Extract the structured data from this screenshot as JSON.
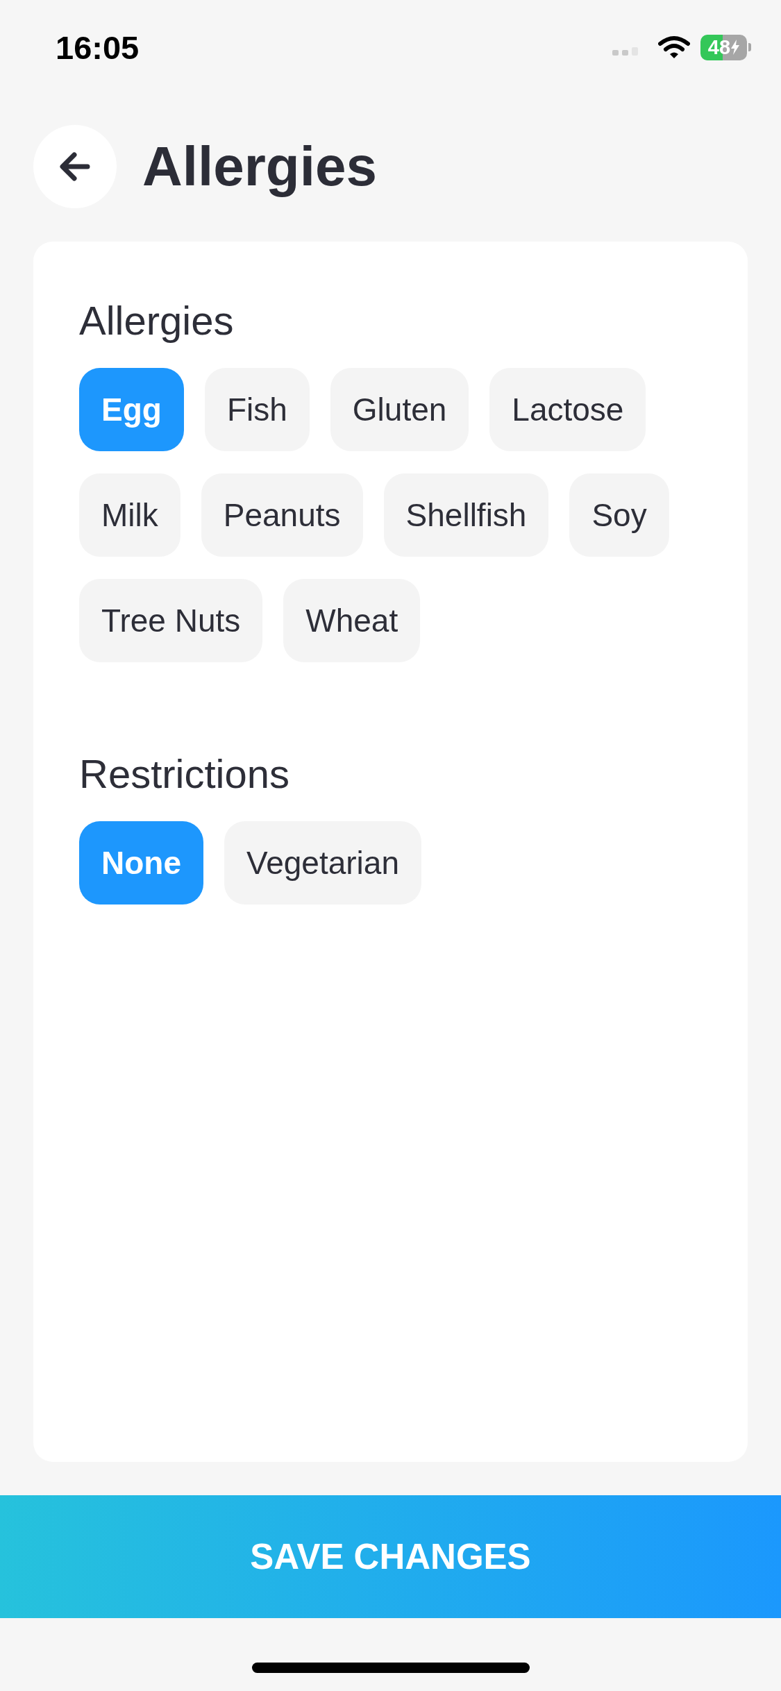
{
  "status_bar": {
    "time": "16:05",
    "battery": "48"
  },
  "header": {
    "title": "Allergies"
  },
  "sections": [
    {
      "title": "Allergies",
      "options": [
        {
          "label": "Egg",
          "selected": true
        },
        {
          "label": "Fish",
          "selected": false
        },
        {
          "label": "Gluten",
          "selected": false
        },
        {
          "label": "Lactose",
          "selected": false
        },
        {
          "label": "Milk",
          "selected": false
        },
        {
          "label": "Peanuts",
          "selected": false
        },
        {
          "label": "Shellfish",
          "selected": false
        },
        {
          "label": "Soy",
          "selected": false
        },
        {
          "label": "Tree Nuts",
          "selected": false
        },
        {
          "label": "Wheat",
          "selected": false
        }
      ]
    },
    {
      "title": "Restrictions",
      "options": [
        {
          "label": "None",
          "selected": true
        },
        {
          "label": "Vegetarian",
          "selected": false
        }
      ]
    }
  ],
  "save_button": {
    "label": "SAVE CHANGES"
  }
}
